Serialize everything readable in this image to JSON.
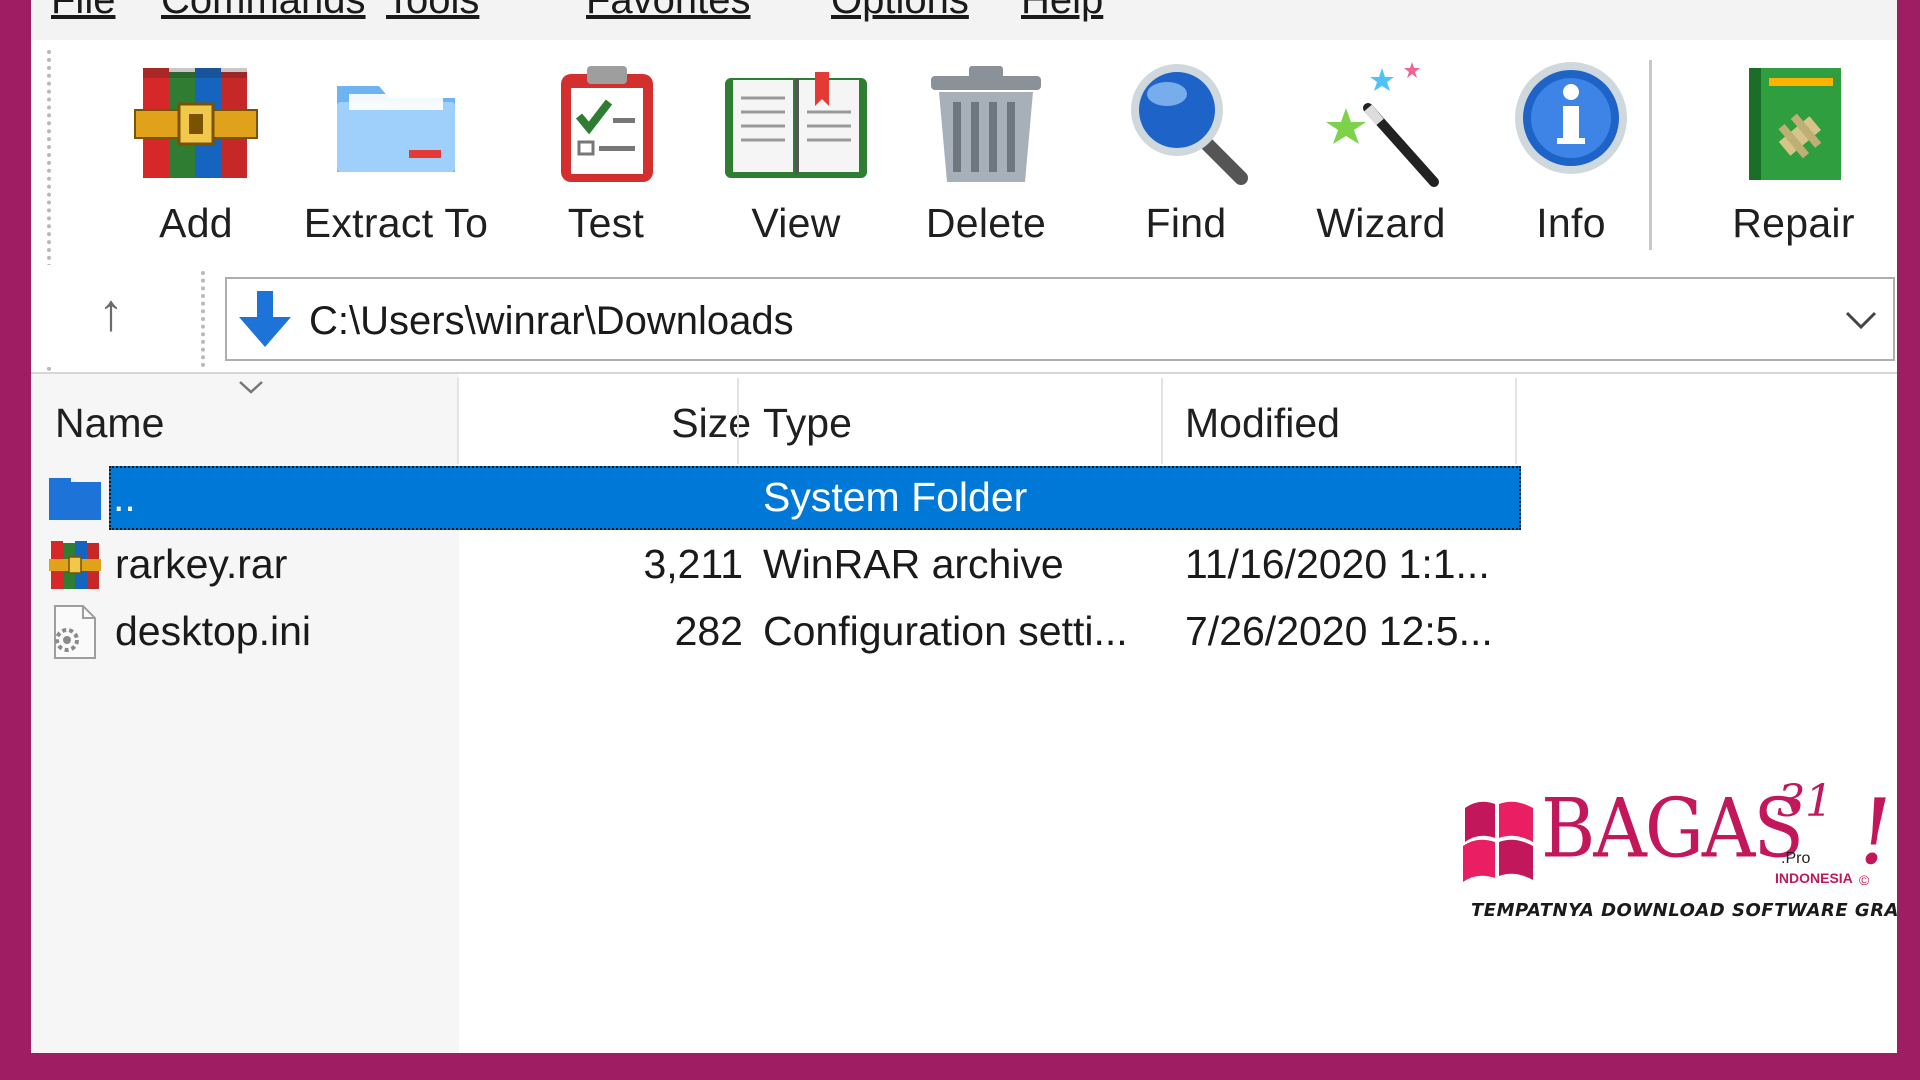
{
  "menubar": {
    "items": [
      "File",
      "Commands",
      "Tools",
      "Favorites",
      "Options",
      "Help"
    ]
  },
  "toolbar": {
    "buttons": [
      {
        "label": "Add",
        "icon": "archive-books-icon"
      },
      {
        "label": "Extract To",
        "icon": "folder-icon"
      },
      {
        "label": "Test",
        "icon": "clipboard-check-icon"
      },
      {
        "label": "View",
        "icon": "open-book-icon"
      },
      {
        "label": "Delete",
        "icon": "trash-can-icon"
      },
      {
        "label": "Find",
        "icon": "magnifier-icon"
      },
      {
        "label": "Wizard",
        "icon": "magic-wand-icon"
      },
      {
        "label": "Info",
        "icon": "info-icon"
      },
      {
        "label": "Repair",
        "icon": "repair-book-icon"
      }
    ]
  },
  "address": {
    "path": "C:\\Users\\winrar\\Downloads"
  },
  "columns": {
    "name": "Name",
    "size": "Size",
    "type": "Type",
    "modified": "Modified"
  },
  "files": [
    {
      "name": "..",
      "size": "",
      "type": "System Folder",
      "modified": "",
      "icon": "folder-icon",
      "selected": true
    },
    {
      "name": "rarkey.rar",
      "size": "3,211",
      "type": "WinRAR archive",
      "modified": "11/16/2020 1:1...",
      "icon": "rar-archive-icon",
      "selected": false
    },
    {
      "name": "desktop.ini",
      "size": "282",
      "type": "Configuration setti...",
      "modified": "7/26/2020 12:5...",
      "icon": "config-file-icon",
      "selected": false
    }
  ],
  "watermark": {
    "brand": "BAGAS",
    "number": "31",
    "suffix": ".Pro",
    "region": "INDONESIA",
    "tagline": "TEMPATNYA DOWNLOAD SOFTWARE GRATIS"
  },
  "colors": {
    "frame": "#9e1d63",
    "selection": "#0078d7",
    "brand": "#c2185b"
  }
}
